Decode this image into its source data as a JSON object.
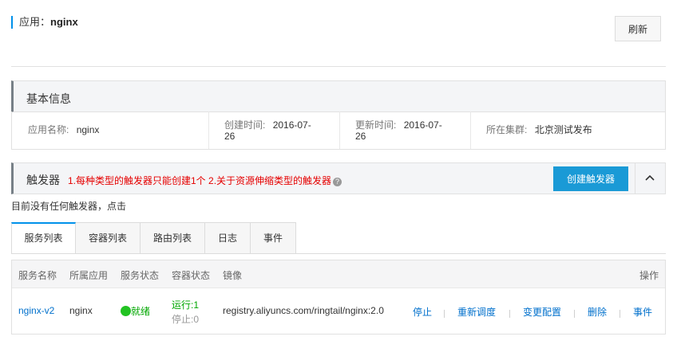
{
  "header": {
    "app_label": "应用：",
    "app_name": "nginx",
    "refresh_label": "刷新"
  },
  "basic_info": {
    "title": "基本信息",
    "fields": [
      {
        "label": "应用名称:",
        "value": "nginx"
      },
      {
        "label": "创建时间:",
        "value_line1": "2016-07-",
        "value_line2": "26"
      },
      {
        "label": "更新时间:",
        "value_line1": "2016-07-",
        "value_line2": "26"
      },
      {
        "label": "所在集群:",
        "value": "北京测试发布"
      }
    ]
  },
  "triggers": {
    "title": "触发器",
    "note": "1.每种类型的触发器只能创建1个   2.关于资源伸缩类型的触发器",
    "help_icon": "question-circle-icon",
    "help_glyph": "?",
    "create_label": "创建触发器",
    "collapse_icon": "chevron-up-icon",
    "empty_text": "目前没有任何触发器，点击"
  },
  "tabs": [
    {
      "label": "服务列表",
      "active": true
    },
    {
      "label": "容器列表",
      "active": false
    },
    {
      "label": "路由列表",
      "active": false
    },
    {
      "label": "日志",
      "active": false
    },
    {
      "label": "事件",
      "active": false
    }
  ],
  "table": {
    "columns": [
      "服务名称",
      "所属应用",
      "服务状态",
      "容器状态",
      "镜像",
      "操作"
    ],
    "rows": [
      {
        "service_name": "nginx-v2",
        "app": "nginx",
        "status": "就绪",
        "container_running": "运行:1",
        "container_stopped": "停止:0",
        "image": "registry.aliyuncs.com/ringtail/nginx:2.0",
        "actions": [
          "停止",
          "重新调度",
          "变更配置",
          "删除",
          "事件"
        ]
      }
    ]
  },
  "colors": {
    "accent": "#0091ea",
    "primary_button": "#1a9ad6",
    "warning_text": "#e50000",
    "status_green": "#22c322",
    "link": "#0070cc"
  }
}
